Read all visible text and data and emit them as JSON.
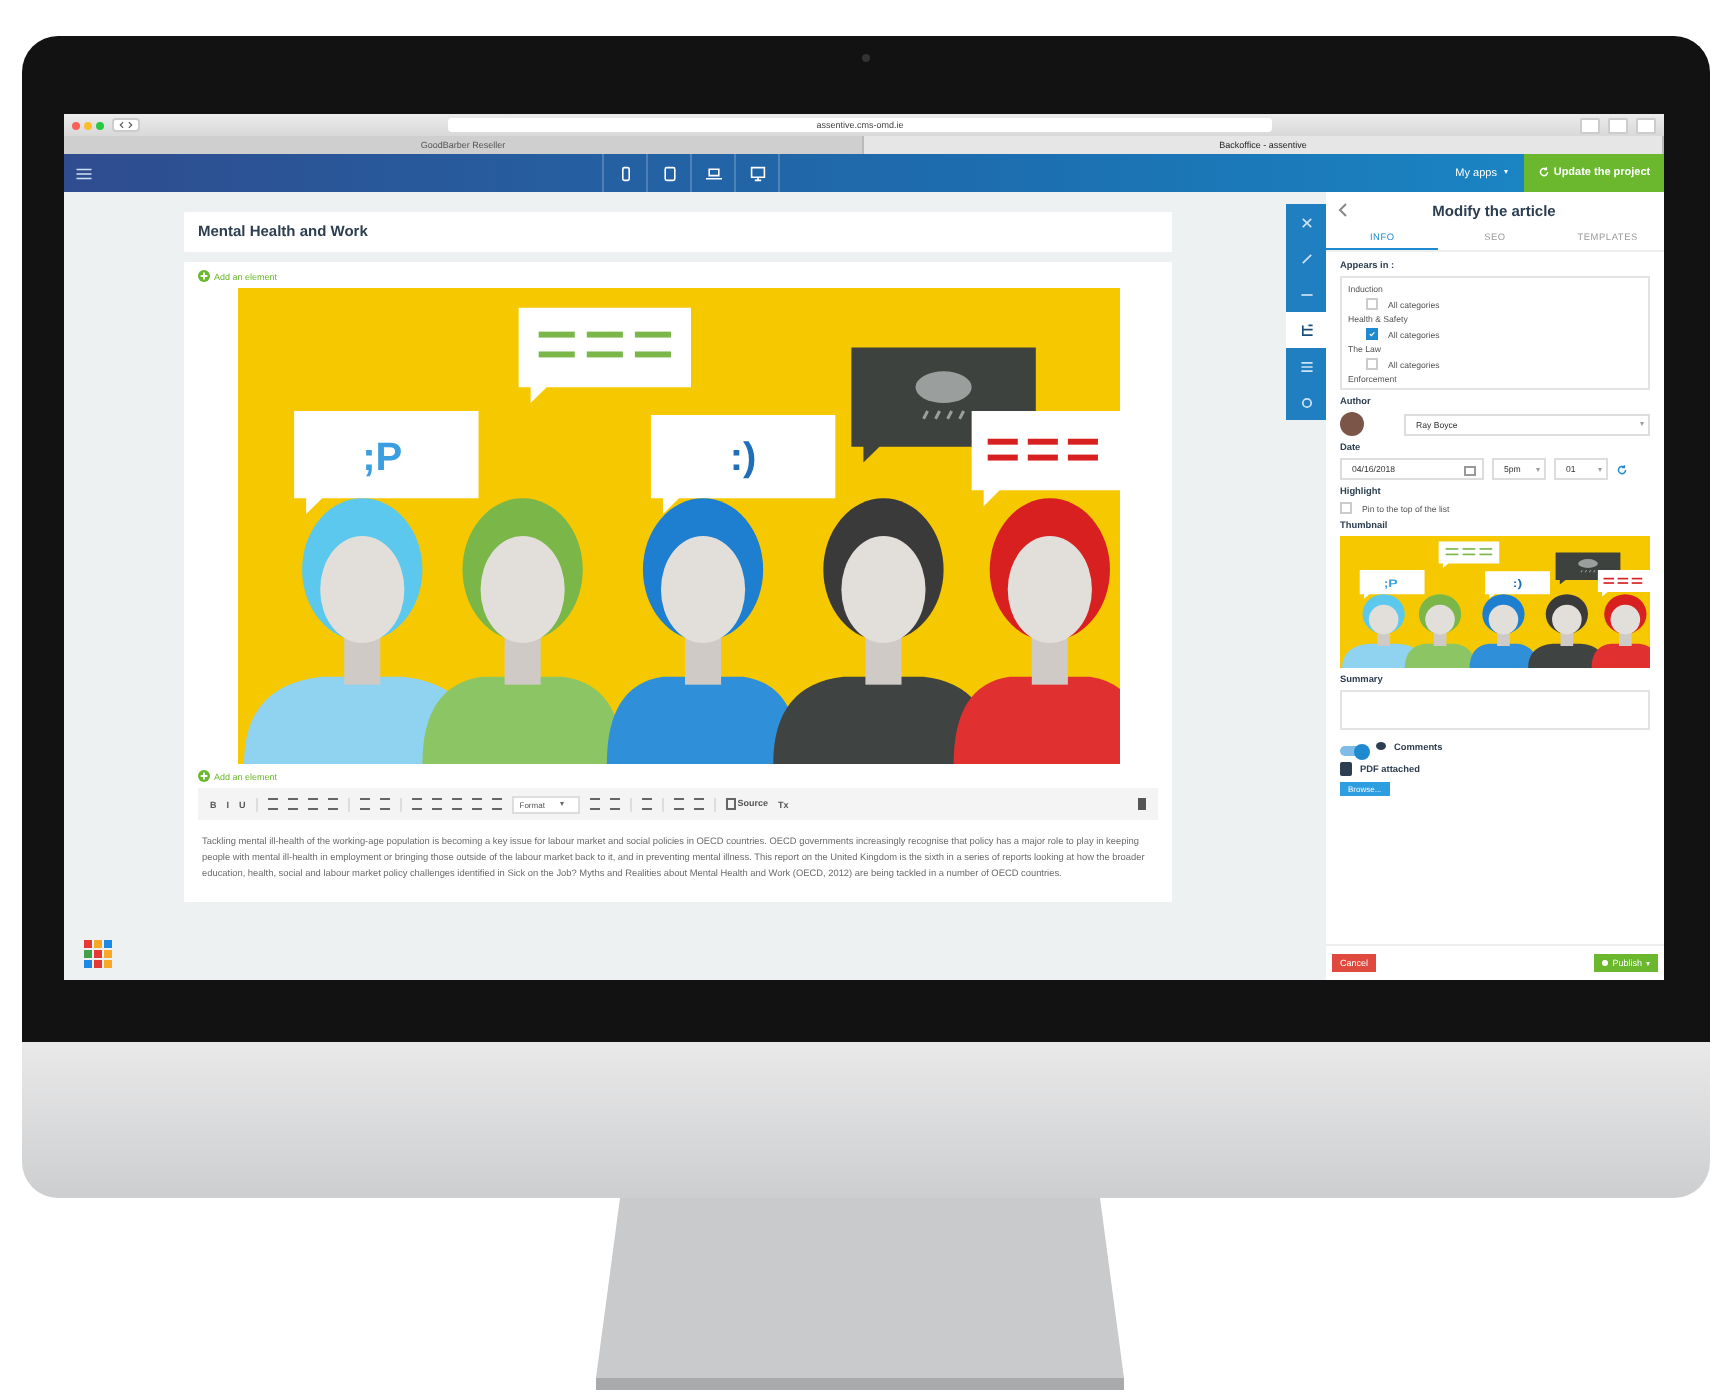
{
  "browser": {
    "url": "assentive.cms-omd.ie",
    "tabs": [
      {
        "label": "GoodBarber Reseller",
        "selected": false
      },
      {
        "label": "Backoffice - assentive",
        "selected": true
      }
    ]
  },
  "appbar": {
    "devices": [
      {
        "kind": "phone"
      },
      {
        "kind": "tablet"
      },
      {
        "kind": "laptop"
      },
      {
        "kind": "desktop"
      }
    ],
    "my_apps": "My apps",
    "update_button": "Update the project"
  },
  "editor": {
    "title": "Mental Health and Work",
    "add_element_top": "Add an element",
    "illustration": {
      "bubbles": [
        ";P",
        ":)"
      ]
    },
    "add_element_bottom": "Add an element",
    "toolbar": [
      {
        "kind": "text",
        "label": "B"
      },
      {
        "kind": "text",
        "label": "I"
      },
      {
        "kind": "text",
        "label": "U"
      },
      {
        "kind": "sep"
      },
      {
        "kind": "icon"
      },
      {
        "kind": "icon"
      },
      {
        "kind": "icon"
      },
      {
        "kind": "icon"
      },
      {
        "kind": "sep"
      },
      {
        "kind": "icon"
      },
      {
        "kind": "icon"
      },
      {
        "kind": "sep"
      },
      {
        "kind": "icon"
      },
      {
        "kind": "icon"
      },
      {
        "kind": "icon"
      },
      {
        "kind": "icon"
      },
      {
        "kind": "icon"
      },
      {
        "kind": "select",
        "label": "Format"
      },
      {
        "kind": "icon"
      },
      {
        "kind": "icon"
      },
      {
        "kind": "sep"
      },
      {
        "kind": "icon"
      },
      {
        "kind": "sep"
      },
      {
        "kind": "icon"
      },
      {
        "kind": "icon"
      },
      {
        "kind": "sep"
      },
      {
        "kind": "source",
        "label": "Source"
      },
      {
        "kind": "text",
        "label": "Tx"
      }
    ],
    "body": "Tackling mental ill-health of the working-age population is becoming a key issue for labour market and social policies in OECD countries. OECD governments increasingly recognise that policy has a major role to play in keeping people with mental ill-health in employment or bringing those outside of the labour market back to it, and in preventing mental illness. This report on the United Kingdom is the sixth in a series of reports looking at how the broader education, health, social and labour market policy challenges identified in Sick on the Job? Myths and Realities about Mental Health and Work (OECD, 2012) are being tackled in a number of OECD countries."
  },
  "tools": [
    {
      "kind": "close",
      "selected": false
    },
    {
      "kind": "brush",
      "selected": false
    },
    {
      "kind": "minus",
      "selected": false
    },
    {
      "kind": "tree",
      "selected": true
    },
    {
      "kind": "list",
      "selected": false
    },
    {
      "kind": "gear",
      "selected": false
    }
  ],
  "sidebar": {
    "title": "Modify the article",
    "tabs": [
      {
        "label": "INFO",
        "selected": true
      },
      {
        "label": "SEO",
        "selected": false
      },
      {
        "label": "TEMPLATES",
        "selected": false
      }
    ],
    "appears_label": "Appears in :",
    "groups": [
      {
        "name": "Induction",
        "option": "All categories",
        "checked": false
      },
      {
        "name": "Health & Safety",
        "option": "All categories",
        "checked": true
      },
      {
        "name": "The Law",
        "option": "All categories",
        "checked": false
      },
      {
        "name": "Enforcement"
      }
    ],
    "author_label": "Author",
    "author": "Ray Boyce",
    "date_label": "Date",
    "date": "04/16/2018",
    "hour": "5pm",
    "minute": "01",
    "highlight_label": "Highlight",
    "highlight": {
      "label": "Pin to the top of the list",
      "checked": false
    },
    "thumbnail_label": "Thumbnail",
    "thumbnail": {
      "bubbles": [
        ";P",
        ":)"
      ]
    },
    "summary_label": "Summary",
    "comments": {
      "label": "Comments",
      "on": true
    },
    "pdf_label": "PDF attached",
    "browse": "Browse...",
    "cancel": "Cancel",
    "publish": "Publish"
  }
}
